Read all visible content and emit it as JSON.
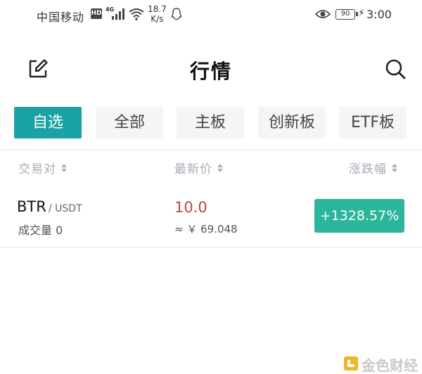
{
  "status_bar": {
    "carrier": "中国移动",
    "hd_badge": "HD",
    "network": "4G",
    "speed_value": "18.7",
    "speed_unit": "K/s",
    "battery": "90",
    "time": "3:00"
  },
  "header": {
    "title": "行情",
    "edit_icon": "edit-icon",
    "search_icon": "search-icon"
  },
  "tabs": [
    {
      "label": "自选",
      "active": true
    },
    {
      "label": "全部",
      "active": false
    },
    {
      "label": "主板",
      "active": false
    },
    {
      "label": "创新板",
      "active": false
    },
    {
      "label": "ETF板",
      "active": false
    }
  ],
  "columns": {
    "pair": "交易对",
    "price": "最新价",
    "change": "涨跌幅"
  },
  "rows": [
    {
      "base": "BTR",
      "quote": "/ USDT",
      "volume": "成交量 0",
      "price": "10.0",
      "price_cny": "≈ ￥ 69.048",
      "change": "+1328.57%"
    }
  ],
  "colors": {
    "accent": "#1aa2a4",
    "up": "#2bb59a",
    "price": "#b54a44"
  },
  "watermark": {
    "text": "金色财经"
  }
}
